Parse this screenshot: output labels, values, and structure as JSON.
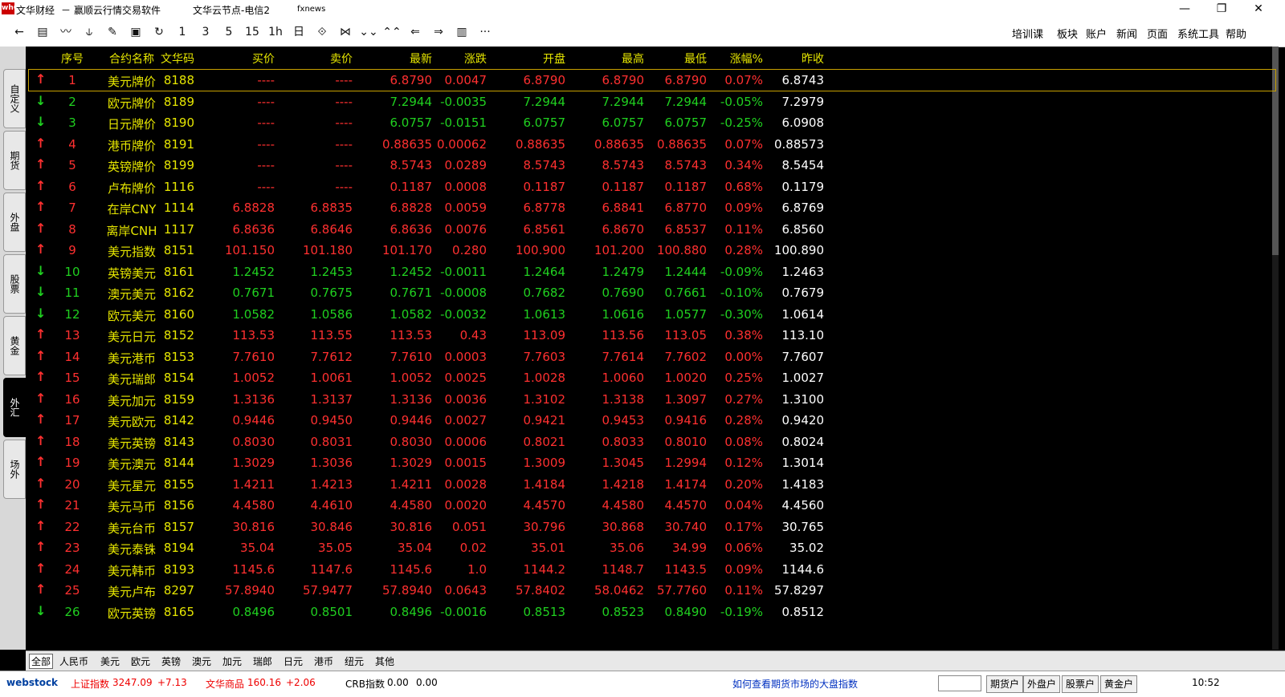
{
  "title": {
    "app_name": "文华财经",
    "sep": "－",
    "software": "赢顺云行情交易软件",
    "node": "文华云节点-电信2",
    "news": "fxnews",
    "logo_text": "wh6"
  },
  "window_controls": {
    "minimize": "—",
    "maximize": "❐",
    "close": "✕"
  },
  "toolbar": {
    "buttons": [
      "←",
      "▤",
      "〰",
      "⫝",
      "✎",
      "▣",
      "↻",
      "1",
      "3",
      "5",
      "15",
      "1h",
      "日",
      "⟐",
      "⋈",
      "⌄⌄",
      "⌃⌃",
      "⇐",
      "⇒",
      "▥",
      "···"
    ],
    "menus": [
      "培训课",
      "板块",
      "账户",
      "新闻",
      "页面",
      "系统工具",
      "帮助"
    ]
  },
  "sidebar": {
    "tabs": [
      "自定义",
      "期货",
      "外盘",
      "股票",
      "黄金",
      "外汇",
      "场外"
    ],
    "active": "外汇"
  },
  "table": {
    "headers": [
      "序号",
      "合约名称",
      "文华码",
      "买价",
      "卖价",
      "最新",
      "涨跌",
      "开盘",
      "最高",
      "最低",
      "涨幅%",
      "昨收"
    ],
    "rows": [
      {
        "dir": "up",
        "no": "1",
        "name": "美元牌价",
        "code": "8188",
        "bid": "----",
        "ask": "----",
        "last": "6.8790",
        "chg": "0.0047",
        "open": "6.8790",
        "high": "6.8790",
        "low": "6.8790",
        "pct": "0.07%",
        "prev": "6.8743"
      },
      {
        "dir": "dn",
        "no": "2",
        "name": "欧元牌价",
        "code": "8189",
        "bid": "----",
        "ask": "----",
        "last": "7.2944",
        "chg": "-0.0035",
        "open": "7.2944",
        "high": "7.2944",
        "low": "7.2944",
        "pct": "-0.05%",
        "prev": "7.2979"
      },
      {
        "dir": "dn",
        "no": "3",
        "name": "日元牌价",
        "code": "8190",
        "bid": "----",
        "ask": "----",
        "last": "6.0757",
        "chg": "-0.0151",
        "open": "6.0757",
        "high": "6.0757",
        "low": "6.0757",
        "pct": "-0.25%",
        "prev": "6.0908"
      },
      {
        "dir": "up",
        "no": "4",
        "name": "港币牌价",
        "code": "8191",
        "bid": "----",
        "ask": "----",
        "last": "0.88635",
        "chg": "0.00062",
        "open": "0.88635",
        "high": "0.88635",
        "low": "0.88635",
        "pct": "0.07%",
        "prev": "0.88573"
      },
      {
        "dir": "up",
        "no": "5",
        "name": "英镑牌价",
        "code": "8199",
        "bid": "----",
        "ask": "----",
        "last": "8.5743",
        "chg": "0.0289",
        "open": "8.5743",
        "high": "8.5743",
        "low": "8.5743",
        "pct": "0.34%",
        "prev": "8.5454"
      },
      {
        "dir": "up",
        "no": "6",
        "name": "卢布牌价",
        "code": "1116",
        "bid": "----",
        "ask": "----",
        "last": "0.1187",
        "chg": "0.0008",
        "open": "0.1187",
        "high": "0.1187",
        "low": "0.1187",
        "pct": "0.68%",
        "prev": "0.1179"
      },
      {
        "dir": "up",
        "no": "7",
        "name": "在岸CNY",
        "code": "1114",
        "bid": "6.8828",
        "ask": "6.8835",
        "last": "6.8828",
        "chg": "0.0059",
        "open": "6.8778",
        "high": "6.8841",
        "low": "6.8770",
        "pct": "0.09%",
        "prev": "6.8769"
      },
      {
        "dir": "up",
        "no": "8",
        "name": "离岸CNH",
        "code": "1117",
        "bid": "6.8636",
        "ask": "6.8646",
        "last": "6.8636",
        "chg": "0.0076",
        "open": "6.8561",
        "high": "6.8670",
        "low": "6.8537",
        "pct": "0.11%",
        "prev": "6.8560"
      },
      {
        "dir": "up",
        "no": "9",
        "name": "美元指数",
        "code": "8151",
        "bid": "101.150",
        "ask": "101.180",
        "last": "101.170",
        "chg": "0.280",
        "open": "100.900",
        "high": "101.200",
        "low": "100.880",
        "pct": "0.28%",
        "prev": "100.890"
      },
      {
        "dir": "dn",
        "no": "10",
        "name": "英镑美元",
        "code": "8161",
        "bid": "1.2452",
        "ask": "1.2453",
        "last": "1.2452",
        "chg": "-0.0011",
        "open": "1.2464",
        "high": "1.2479",
        "low": "1.2444",
        "pct": "-0.09%",
        "prev": "1.2463"
      },
      {
        "dir": "dn",
        "no": "11",
        "name": "澳元美元",
        "code": "8162",
        "bid": "0.7671",
        "ask": "0.7675",
        "last": "0.7671",
        "chg": "-0.0008",
        "open": "0.7682",
        "high": "0.7690",
        "low": "0.7661",
        "pct": "-0.10%",
        "prev": "0.7679"
      },
      {
        "dir": "dn",
        "no": "12",
        "name": "欧元美元",
        "code": "8160",
        "bid": "1.0582",
        "ask": "1.0586",
        "last": "1.0582",
        "chg": "-0.0032",
        "open": "1.0613",
        "high": "1.0616",
        "low": "1.0577",
        "pct": "-0.30%",
        "prev": "1.0614"
      },
      {
        "dir": "up",
        "no": "13",
        "name": "美元日元",
        "code": "8152",
        "bid": "113.53",
        "ask": "113.55",
        "last": "113.53",
        "chg": "0.43",
        "open": "113.09",
        "high": "113.56",
        "low": "113.05",
        "pct": "0.38%",
        "prev": "113.10"
      },
      {
        "dir": "up",
        "no": "14",
        "name": "美元港币",
        "code": "8153",
        "bid": "7.7610",
        "ask": "7.7612",
        "last": "7.7610",
        "chg": "0.0003",
        "open": "7.7603",
        "high": "7.7614",
        "low": "7.7602",
        "pct": "0.00%",
        "prev": "7.7607"
      },
      {
        "dir": "up",
        "no": "15",
        "name": "美元瑞郎",
        "code": "8154",
        "bid": "1.0052",
        "ask": "1.0061",
        "last": "1.0052",
        "chg": "0.0025",
        "open": "1.0028",
        "high": "1.0060",
        "low": "1.0020",
        "pct": "0.25%",
        "prev": "1.0027"
      },
      {
        "dir": "up",
        "no": "16",
        "name": "美元加元",
        "code": "8159",
        "bid": "1.3136",
        "ask": "1.3137",
        "last": "1.3136",
        "chg": "0.0036",
        "open": "1.3102",
        "high": "1.3138",
        "low": "1.3097",
        "pct": "0.27%",
        "prev": "1.3100"
      },
      {
        "dir": "up",
        "no": "17",
        "name": "美元欧元",
        "code": "8142",
        "bid": "0.9446",
        "ask": "0.9450",
        "last": "0.9446",
        "chg": "0.0027",
        "open": "0.9421",
        "high": "0.9453",
        "low": "0.9416",
        "pct": "0.28%",
        "prev": "0.9420"
      },
      {
        "dir": "up",
        "no": "18",
        "name": "美元英镑",
        "code": "8143",
        "bid": "0.8030",
        "ask": "0.8031",
        "last": "0.8030",
        "chg": "0.0006",
        "open": "0.8021",
        "high": "0.8033",
        "low": "0.8010",
        "pct": "0.08%",
        "prev": "0.8024"
      },
      {
        "dir": "up",
        "no": "19",
        "name": "美元澳元",
        "code": "8144",
        "bid": "1.3029",
        "ask": "1.3036",
        "last": "1.3029",
        "chg": "0.0015",
        "open": "1.3009",
        "high": "1.3045",
        "low": "1.2994",
        "pct": "0.12%",
        "prev": "1.3014"
      },
      {
        "dir": "up",
        "no": "20",
        "name": "美元星元",
        "code": "8155",
        "bid": "1.4211",
        "ask": "1.4213",
        "last": "1.4211",
        "chg": "0.0028",
        "open": "1.4184",
        "high": "1.4218",
        "low": "1.4174",
        "pct": "0.20%",
        "prev": "1.4183"
      },
      {
        "dir": "up",
        "no": "21",
        "name": "美元马币",
        "code": "8156",
        "bid": "4.4580",
        "ask": "4.4610",
        "last": "4.4580",
        "chg": "0.0020",
        "open": "4.4570",
        "high": "4.4580",
        "low": "4.4570",
        "pct": "0.04%",
        "prev": "4.4560"
      },
      {
        "dir": "up",
        "no": "22",
        "name": "美元台币",
        "code": "8157",
        "bid": "30.816",
        "ask": "30.846",
        "last": "30.816",
        "chg": "0.051",
        "open": "30.796",
        "high": "30.868",
        "low": "30.740",
        "pct": "0.17%",
        "prev": "30.765"
      },
      {
        "dir": "up",
        "no": "23",
        "name": "美元泰铢",
        "code": "8194",
        "bid": "35.04",
        "ask": "35.05",
        "last": "35.04",
        "chg": "0.02",
        "open": "35.01",
        "high": "35.06",
        "low": "34.99",
        "pct": "0.06%",
        "prev": "35.02"
      },
      {
        "dir": "up",
        "no": "24",
        "name": "美元韩币",
        "code": "8193",
        "bid": "1145.6",
        "ask": "1147.6",
        "last": "1145.6",
        "chg": "1.0",
        "open": "1144.2",
        "high": "1148.7",
        "low": "1143.5",
        "pct": "0.09%",
        "prev": "1144.6"
      },
      {
        "dir": "up",
        "no": "25",
        "name": "美元卢布",
        "code": "8297",
        "bid": "57.8940",
        "ask": "57.9477",
        "last": "57.8940",
        "chg": "0.0643",
        "open": "57.8402",
        "high": "58.0462",
        "low": "57.7760",
        "pct": "0.11%",
        "prev": "57.8297"
      },
      {
        "dir": "dn",
        "no": "26",
        "name": "欧元英镑",
        "code": "8165",
        "bid": "0.8496",
        "ask": "0.8501",
        "last": "0.8496",
        "chg": "-0.0016",
        "open": "0.8513",
        "high": "0.8523",
        "low": "0.8490",
        "pct": "-0.19%",
        "prev": "0.8512"
      }
    ]
  },
  "bottom_tabs": [
    "全部",
    "人民币",
    "美元",
    "欧元",
    "英镑",
    "澳元",
    "加元",
    "瑞郎",
    "日元",
    "港币",
    "纽元",
    "其他"
  ],
  "bottom_tabs_active": "全部",
  "status": {
    "brand": "webstock",
    "sh_label": "上证指数",
    "sh_value": "3247.09",
    "sh_change": "+7.13",
    "wh_label": "文华商品",
    "wh_value": "160.16",
    "wh_change": "+2.06",
    "crb_label": "CRB指数",
    "crb_value": "0.00",
    "crb_change": "0.00",
    "hint": "如何查看期货市场的大盘指数",
    "buttons": [
      "期货户",
      "外盘户",
      "股票户",
      "黄金户"
    ],
    "time": "10:52"
  },
  "colors": {
    "up": "#ff3030",
    "down": "#20d020",
    "header": "#e6e600",
    "name": "#e6e600",
    "code": "#e6e600"
  }
}
